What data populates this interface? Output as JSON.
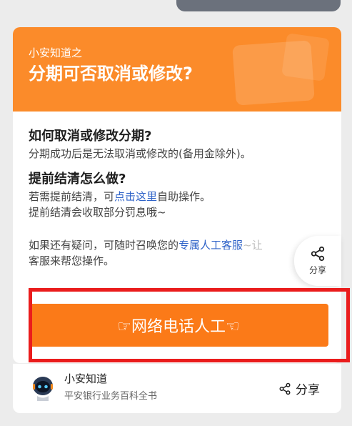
{
  "header": {
    "subtitle": "小安知道之",
    "title": "分期可否取消或修改?"
  },
  "section1": {
    "question": "如何取消或修改分期?",
    "answer": "分期成功后是无法取消或修改的(备用金除外)。"
  },
  "section2": {
    "question": "提前结清怎么做?",
    "line1_pre": "若需提前结清，可",
    "line1_link": "点击这里",
    "line1_post": "自助操作。",
    "line2": "提前结清会收取部分罚息哦~"
  },
  "section3": {
    "line1_pre": "如果还有疑问，可随时召唤您的",
    "line1_link": "专属人工客服",
    "line1_post": "~让",
    "line2": "客服来帮您操作。"
  },
  "share_float": {
    "label": "分享",
    "icon": "share-icon"
  },
  "call_button": {
    "label": "☞网络电话人工☜"
  },
  "footer": {
    "name": "小安知道",
    "desc": "平安银行业务百科全书",
    "share_label": "分享"
  },
  "colors": {
    "brand_orange": "#fb8b2a",
    "button_orange": "#fb7a18",
    "link_blue": "#2f63c8",
    "highlight_red": "#ea1c1c"
  }
}
